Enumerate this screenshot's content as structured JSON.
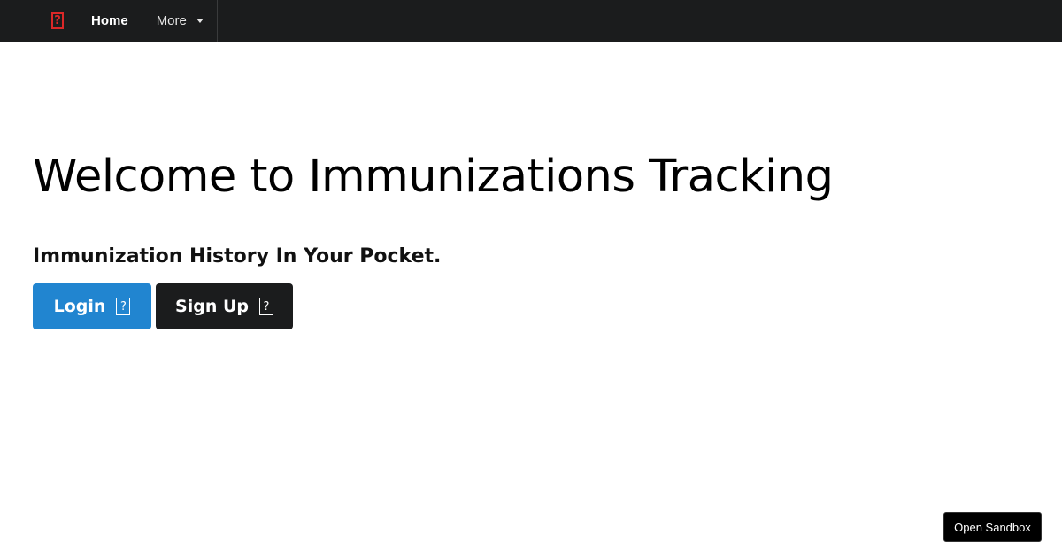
{
  "navbar": {
    "logo_icon": "unknown-glyph-icon",
    "logo_glyph": "?",
    "logo_color": "#db2828",
    "home_label": "Home",
    "more_label": "More"
  },
  "hero": {
    "title": "Welcome to Immunizations Tracking",
    "subtitle": "Immunization History In Your Pocket."
  },
  "actions": {
    "login_label": "Login",
    "login_icon": "unknown-glyph-icon",
    "signup_label": "Sign Up",
    "signup_icon": "unknown-glyph-icon",
    "icon_glyph": "?"
  },
  "sandbox": {
    "label": "Open Sandbox"
  },
  "colors": {
    "navbar_bg": "#1b1c1d",
    "primary": "#2185d0",
    "secondary": "#1b1c1d"
  }
}
